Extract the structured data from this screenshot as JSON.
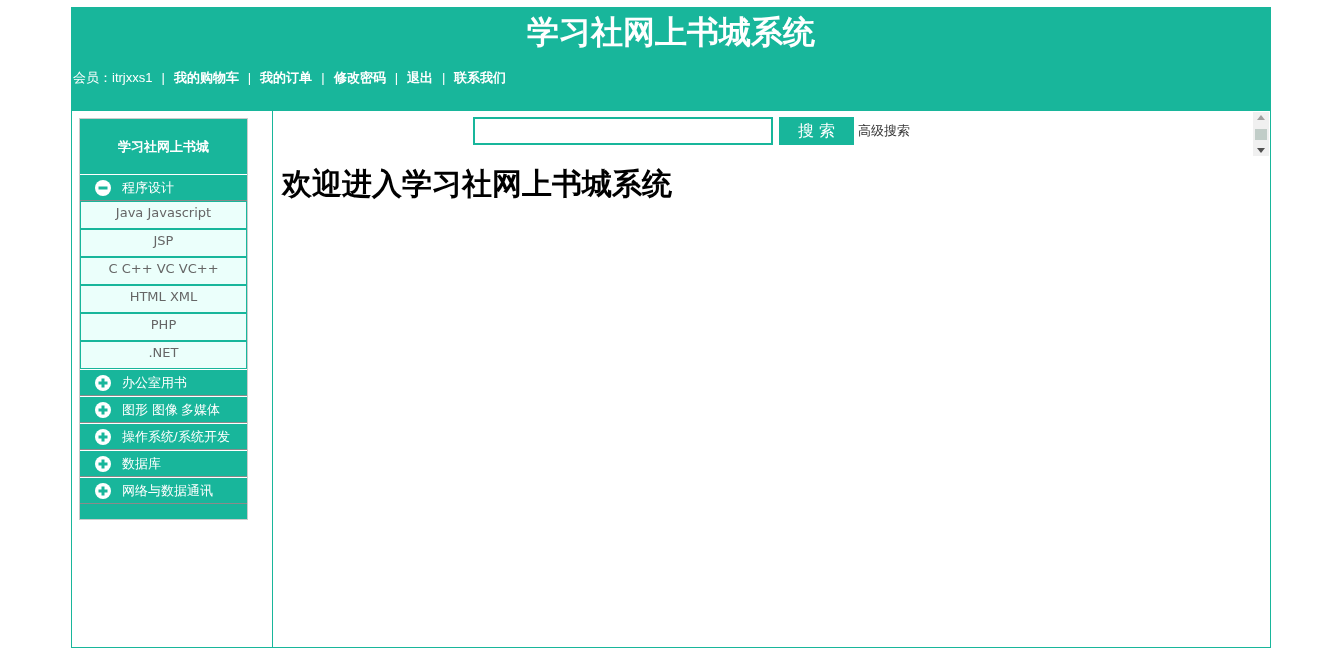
{
  "header": {
    "title": "学习社网上书城系统",
    "nav": [
      {
        "kind": "text",
        "label": "会员：itrjxxs1"
      },
      {
        "kind": "separator",
        "label": "|"
      },
      {
        "kind": "link",
        "label": "我的购物车"
      },
      {
        "kind": "separator",
        "label": "|"
      },
      {
        "kind": "link",
        "label": "我的订单"
      },
      {
        "kind": "separator",
        "label": "|"
      },
      {
        "kind": "link",
        "label": "修改密码"
      },
      {
        "kind": "separator",
        "label": "|"
      },
      {
        "kind": "link",
        "label": "退出"
      },
      {
        "kind": "separator",
        "label": "|"
      },
      {
        "kind": "link",
        "label": "联系我们"
      }
    ]
  },
  "sidebar": {
    "title": "学习社网上书城",
    "categories": [
      {
        "label": "程序设计",
        "expanded": true,
        "children": [
          {
            "label": "Java Javascript"
          },
          {
            "label": "JSP"
          },
          {
            "label": "C C++ VC VC++"
          },
          {
            "label": "HTML XML"
          },
          {
            "label": "PHP"
          },
          {
            "label": ".NET"
          }
        ]
      },
      {
        "label": "办公室用书",
        "expanded": false
      },
      {
        "label": "图形 图像 多媒体",
        "expanded": false
      },
      {
        "label": "操作系统/系统开发",
        "expanded": false
      },
      {
        "label": "数据库",
        "expanded": false
      },
      {
        "label": "网络与数据通讯",
        "expanded": false
      }
    ]
  },
  "search": {
    "button": "搜 索",
    "advanced_link": "高级搜索"
  },
  "welcome_heading": "欢迎进入学习社网上书城系统"
}
